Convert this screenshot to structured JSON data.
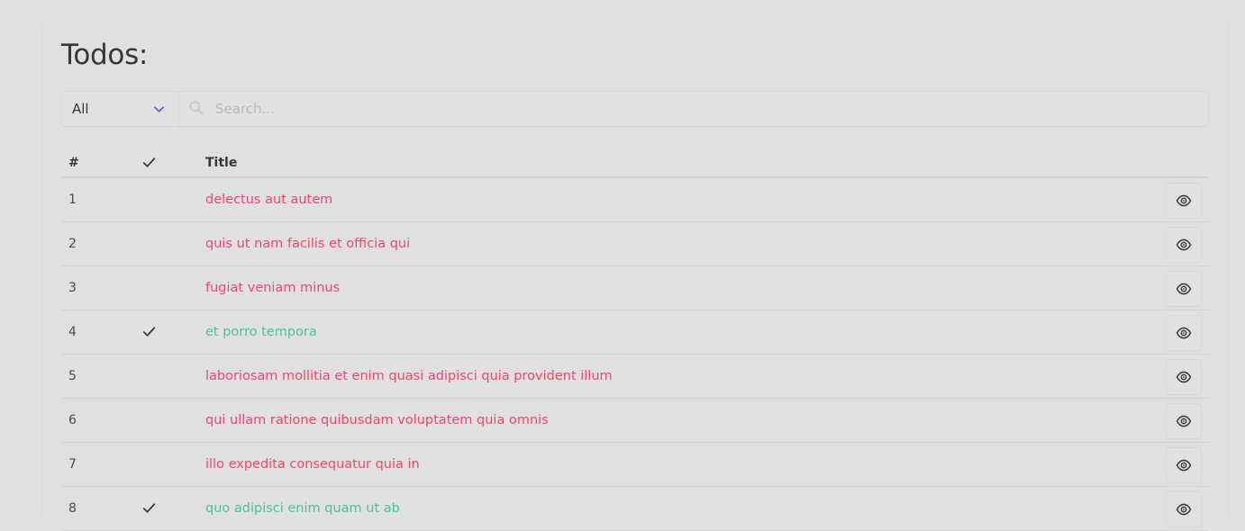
{
  "page": {
    "title": "Todos:"
  },
  "filter": {
    "selected": "All",
    "search_placeholder": "Search..."
  },
  "table": {
    "headers": {
      "number": "#",
      "title": "Title"
    },
    "rows": [
      {
        "id": "1",
        "title": "delectus aut autem",
        "completed": false
      },
      {
        "id": "2",
        "title": "quis ut nam facilis et officia qui",
        "completed": false
      },
      {
        "id": "3",
        "title": "fugiat veniam minus",
        "completed": false
      },
      {
        "id": "4",
        "title": "et porro tempora",
        "completed": true
      },
      {
        "id": "5",
        "title": "laboriosam mollitia et enim quasi adipisci quia provident illum",
        "completed": false
      },
      {
        "id": "6",
        "title": "qui ullam ratione quibusdam voluptatem quia omnis",
        "completed": false
      },
      {
        "id": "7",
        "title": "illo expedita consequatur quia in",
        "completed": false
      },
      {
        "id": "8",
        "title": "quo adipisci enim quam ut ab",
        "completed": true
      }
    ]
  },
  "colors": {
    "pending": "#f1466a",
    "completed": "#48c78e",
    "chevron": "#485fc7"
  },
  "icons": {
    "checkmark": "check-icon",
    "view": "eye-icon",
    "search": "search-icon",
    "dropdown": "chevron-down-icon"
  }
}
